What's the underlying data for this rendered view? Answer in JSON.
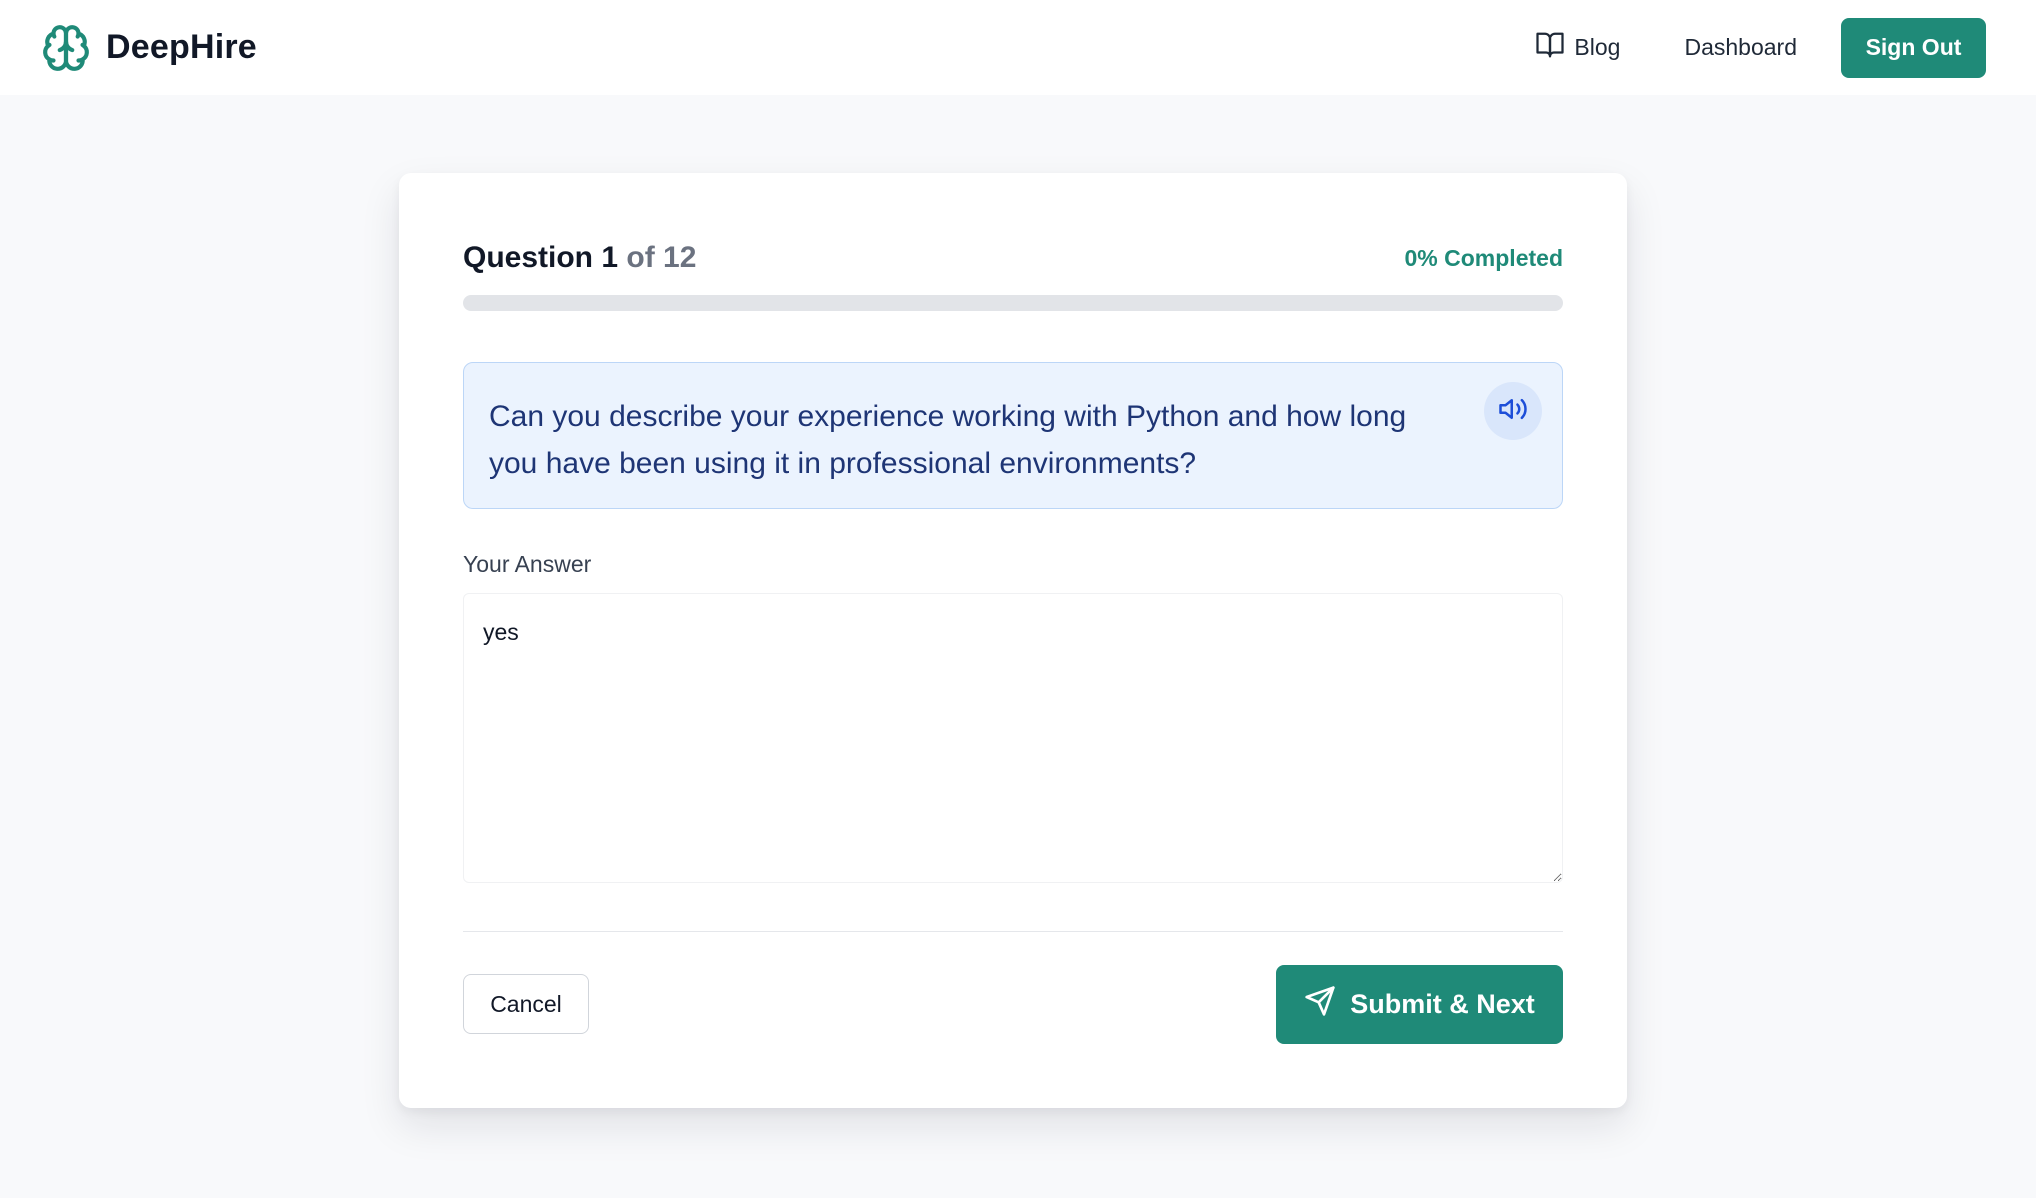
{
  "colors": {
    "brand": "#1f8a78",
    "page_background": "#f8f9fb",
    "question_background": "#ebf3fe",
    "question_text": "#1e3575",
    "speaker_accent": "#1d4ed8"
  },
  "header": {
    "brand_name": "DeepHire",
    "logo_icon": "brain-icon",
    "nav": {
      "blog_label": "Blog",
      "blog_icon": "book-open-icon",
      "dashboard_label": "Dashboard"
    },
    "sign_out_label": "Sign Out"
  },
  "interview": {
    "question_prefix": "Question",
    "question_number": "1",
    "question_of_total": "of 12",
    "progress_text": "0% Completed",
    "progress_percent": 0,
    "question_text": "Can you describe your experience working with Python and how long you have been using it in professional environments?",
    "speaker_icon": "speaker-icon",
    "answer_label": "Your Answer",
    "answer_value": "yes",
    "cancel_label": "Cancel",
    "submit_label": "Submit & Next",
    "submit_icon": "send-icon"
  }
}
